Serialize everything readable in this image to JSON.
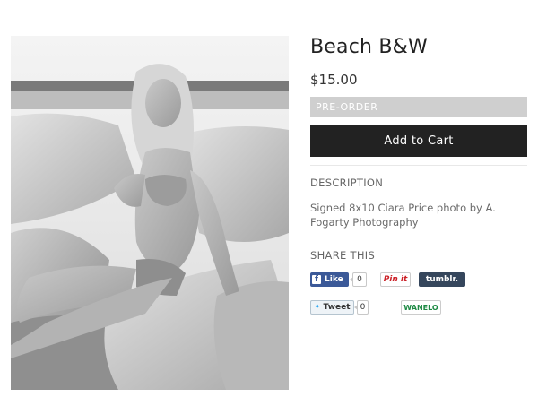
{
  "product": {
    "title": "Beach B&W",
    "price": "$15.00",
    "preorder_label": "PRE-ORDER",
    "add_to_cart_label": "Add to Cart",
    "description_heading": "DESCRIPTION",
    "description": "Signed 8x10 Ciara Price photo by A. Fogarty Photography",
    "share_heading": "SHARE THIS"
  },
  "share": {
    "facebook_label": "Like",
    "facebook_icon": "f",
    "facebook_count": "0",
    "pinterest_label": "Pin it",
    "tumblr_label": "tumblr.",
    "tweet_label": "Tweet",
    "tweet_count": "0",
    "wanelo_label": "WANELO"
  },
  "colors": {
    "cart_button": "#222222",
    "preorder_bar": "#cfcfcf",
    "facebook": "#3b5998",
    "tumblr": "#35465c",
    "pinterest": "#cb2027",
    "wanelo": "#1e8a44"
  }
}
